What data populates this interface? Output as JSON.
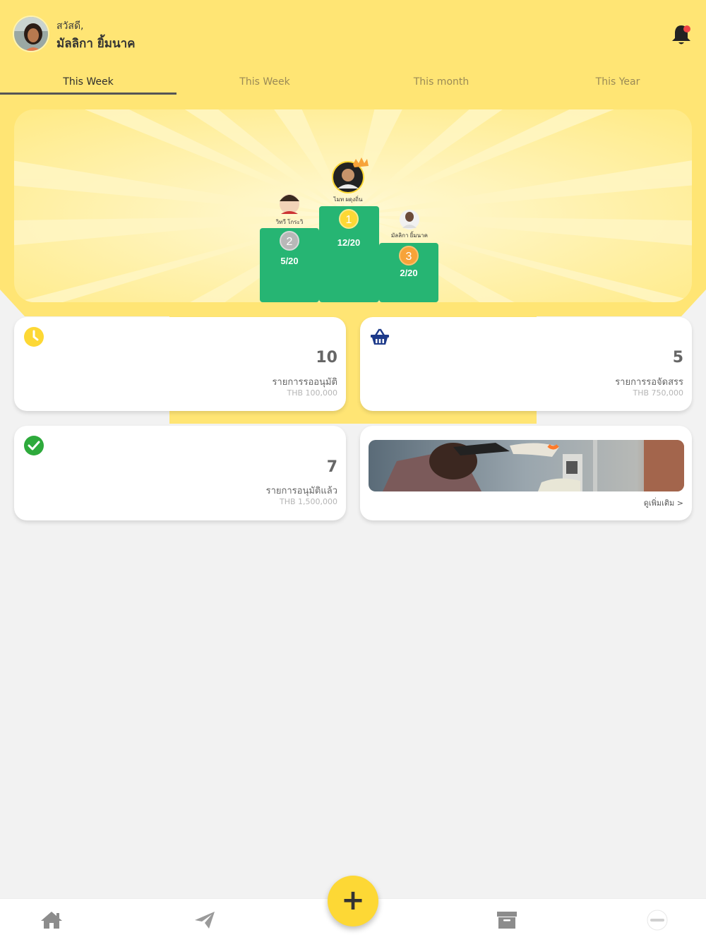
{
  "header": {
    "greeting": "สวัสดี,",
    "user_name": "มัลลิกา ยิ้มนาค"
  },
  "tabs": [
    {
      "label": "This Week",
      "active": true
    },
    {
      "label": "This Week",
      "active": false
    },
    {
      "label": "This month",
      "active": false
    },
    {
      "label": "This Year",
      "active": false
    }
  ],
  "leaderboard": {
    "first": {
      "rank": "1",
      "name": "ไมท ผดุงถิ่น",
      "score": "12/20"
    },
    "second": {
      "rank": "2",
      "name": "วิทวี โกระวิ",
      "score": "5/20"
    },
    "third": {
      "rank": "3",
      "name": "มัลลิกา ยิ้มนาค",
      "score": "2/20"
    }
  },
  "cards": {
    "pending": {
      "icon": "clock-icon",
      "count": "10",
      "label": "รายการรออนุมัติ",
      "amount": "THB 100,000"
    },
    "allocation": {
      "icon": "basket-icon",
      "count": "5",
      "label": "รายการรอจัดสรร",
      "amount": "THB 750,000"
    },
    "approved": {
      "icon": "check-circle-icon",
      "count": "7",
      "label": "รายการอนุมัติแล้ว",
      "amount": "THB 1,500,000"
    },
    "promo": {
      "more_label": "ดูเพิ่มเติม >"
    }
  },
  "bottom_nav": {
    "items": [
      "home-icon",
      "send-icon",
      "add-icon",
      "archive-icon",
      "logo-icon"
    ],
    "fab_label": "+"
  },
  "colors": {
    "brand_yellow": "#fdd835",
    "header_yellow": "#ffe574",
    "podium_green": "#26b573",
    "gold": "#fdd835",
    "silver": "#b8b8b8",
    "bronze": "#f7a339",
    "basket_blue": "#1d3a8a",
    "check_green": "#2eaa3c"
  }
}
